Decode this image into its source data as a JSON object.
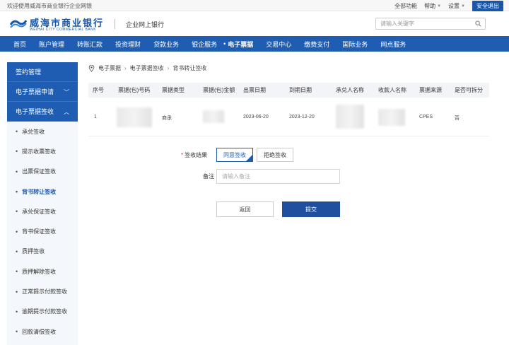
{
  "topbar": {
    "welcome": "欢迎使用威海市商业银行企业网银",
    "links": [
      {
        "label": "全部功能",
        "has_caret": false
      },
      {
        "label": "帮助",
        "has_caret": true
      },
      {
        "label": "设置",
        "has_caret": true
      }
    ],
    "logout": "安全退出"
  },
  "brand": {
    "name": "威海市商业银行",
    "name_en": "WEIHAI CITY COMMERCIAL BANK",
    "site": "企业网上银行",
    "search_placeholder": "请输入关键字"
  },
  "nav": {
    "items": [
      "首页",
      "账户管理",
      "转账汇款",
      "投资理财",
      "贷款业务",
      "银企服务",
      "电子票据",
      "交易中心",
      "缴费支付",
      "国际业务",
      "网点服务"
    ],
    "active_index": 6
  },
  "sidebar": {
    "heads": [
      "签约管理",
      "电子票据申请",
      "电子票据签收"
    ],
    "items": [
      "承兑签收",
      "提示收票签收",
      "出票保证签收",
      "背书转让签收",
      "承兑保证签收",
      "背书保证签收",
      "质押签收",
      "质押解除签收",
      "正常提示付款签收",
      "逾期提示付款签收",
      "回款清偿签收"
    ],
    "active_item": "背书转让签收"
  },
  "breadcrumb": [
    "电子票据",
    "电子票据签收",
    "背书转让签收"
  ],
  "table": {
    "headers": [
      "序号",
      "票据(包)号码",
      "票据类型",
      "票据(包)金额",
      "出票日期",
      "到期日期",
      "承兑人名称",
      "收款人名称",
      "票据来源",
      "是否可拆分"
    ],
    "rows": [
      {
        "index": "1",
        "bill_type": "商承",
        "issue_date": "2023-06-20",
        "due_date": "2023-12-20",
        "source": "CPES",
        "splittable": "否"
      }
    ]
  },
  "form": {
    "result_label": "签收结果",
    "options": [
      "同意签收",
      "拒绝签收"
    ],
    "selected_option": "同意签收",
    "remark_label": "备注",
    "remark_placeholder": "请输入备注",
    "back_button": "返回",
    "submit_button": "提交"
  },
  "colors": {
    "primary": "#1f5db3",
    "submit": "#1f4f9e"
  }
}
